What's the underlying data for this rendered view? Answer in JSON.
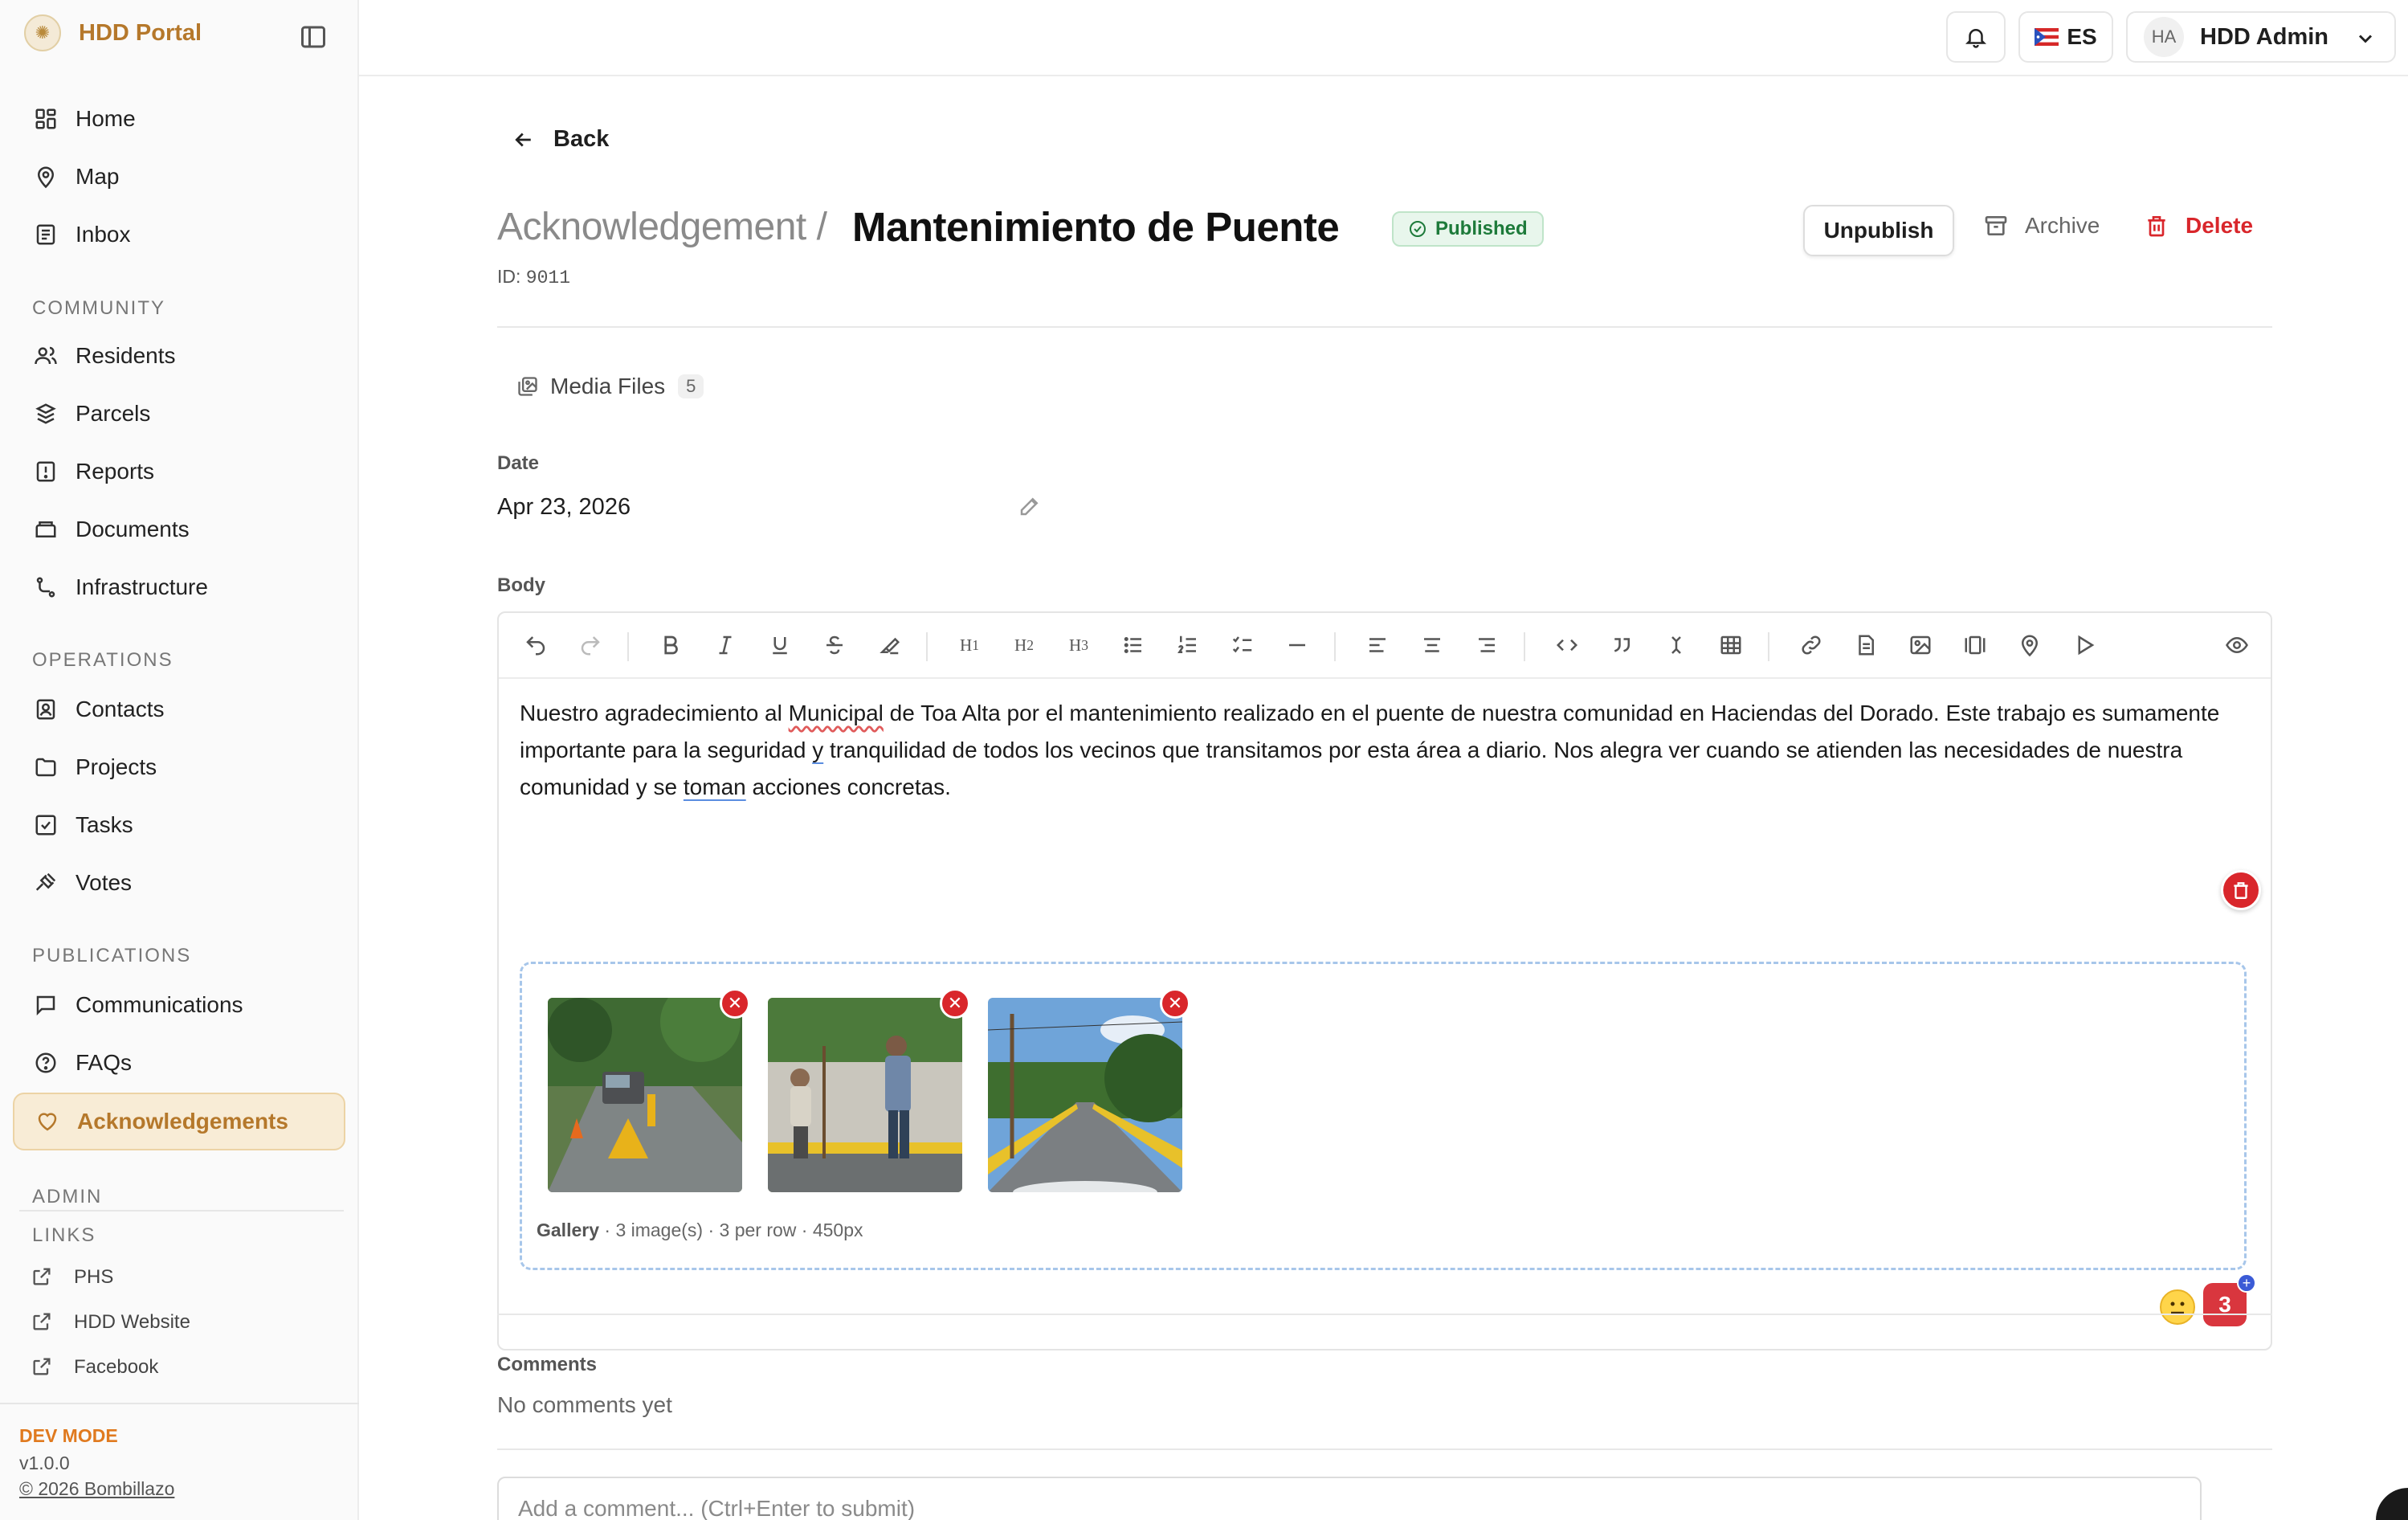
{
  "app": {
    "name": "HDD Portal"
  },
  "sidebar": {
    "nav_main": [
      {
        "label": "Home",
        "icon": "home-icon"
      },
      {
        "label": "Map",
        "icon": "map-pin-icon"
      },
      {
        "label": "Inbox",
        "icon": "inbox-icon"
      }
    ],
    "community_heading": "COMMUNITY",
    "community": [
      {
        "label": "Residents",
        "icon": "users-icon"
      },
      {
        "label": "Parcels",
        "icon": "parcels-icon"
      },
      {
        "label": "Reports",
        "icon": "report-icon"
      },
      {
        "label": "Documents",
        "icon": "documents-icon"
      },
      {
        "label": "Infrastructure",
        "icon": "infrastructure-icon"
      }
    ],
    "operations_heading": "OPERATIONS",
    "operations": [
      {
        "label": "Contacts",
        "icon": "contacts-icon"
      },
      {
        "label": "Projects",
        "icon": "folder-icon"
      },
      {
        "label": "Tasks",
        "icon": "checkbox-icon"
      },
      {
        "label": "Votes",
        "icon": "gavel-icon"
      }
    ],
    "publications_heading": "PUBLICATIONS",
    "publications": [
      {
        "label": "Communications",
        "icon": "message-icon"
      },
      {
        "label": "FAQs",
        "icon": "help-icon"
      },
      {
        "label": "Acknowledgements",
        "icon": "heart-icon",
        "active": true
      }
    ],
    "admin_heading": "ADMIN",
    "links_heading": "LINKS",
    "links": [
      {
        "label": "PHS",
        "icon": "external-link-icon"
      },
      {
        "label": "HDD Website",
        "icon": "external-link-icon"
      },
      {
        "label": "Facebook",
        "icon": "external-link-icon"
      }
    ],
    "dev_mode": "DEV MODE",
    "version": "v1.0.0",
    "copyright": "© 2026 Bombillazo"
  },
  "topbar": {
    "language": "ES",
    "user_initials": "HA",
    "user_name": "HDD Admin"
  },
  "page": {
    "back_label": "Back",
    "breadcrumb_parent": "Acknowledgement /",
    "title": "Mantenimiento de Puente",
    "status": "Published",
    "id_label": "ID:",
    "id_value": "9011",
    "actions": {
      "unpublish": "Unpublish",
      "archive": "Archive",
      "delete": "Delete"
    },
    "media_tab": {
      "label": "Media Files",
      "count": "5"
    },
    "date_label": "Date",
    "date_value": "Apr 23, 2026",
    "body_label": "Body",
    "body": {
      "p1": "Nuestro agradecimiento al ",
      "w_municipal": "Municipal",
      "p2": " de Toa Alta por el mantenimiento realizado en el puente de nuestra comunidad en Haciendas del Dorado.  Este trabajo es sumamente importante para la seguridad ",
      "w_y": "y",
      "p3": " tranquilidad de todos los vecinos que transitamos por esta área a diario. Nos alegra ver cuando se atienden las necesidades de nuestra comunidad y se ",
      "w_toman": "toman",
      "p4": " acciones concretas."
    },
    "gallery": {
      "caption_bold": "Gallery",
      "caption_rest": " · 3 image(s) · 3 per row · 450px"
    },
    "grammar_count": "3",
    "comments_label": "Comments",
    "no_comments": "No comments yet",
    "comment_placeholder": "Add a comment... (Ctrl+Enter to submit)"
  },
  "colors": {
    "brand": "#b5782b",
    "active_bg": "#f8ecd6",
    "danger": "#d9262b",
    "published_green": "#1d7a3a",
    "dev_orange": "#e07a1f"
  }
}
